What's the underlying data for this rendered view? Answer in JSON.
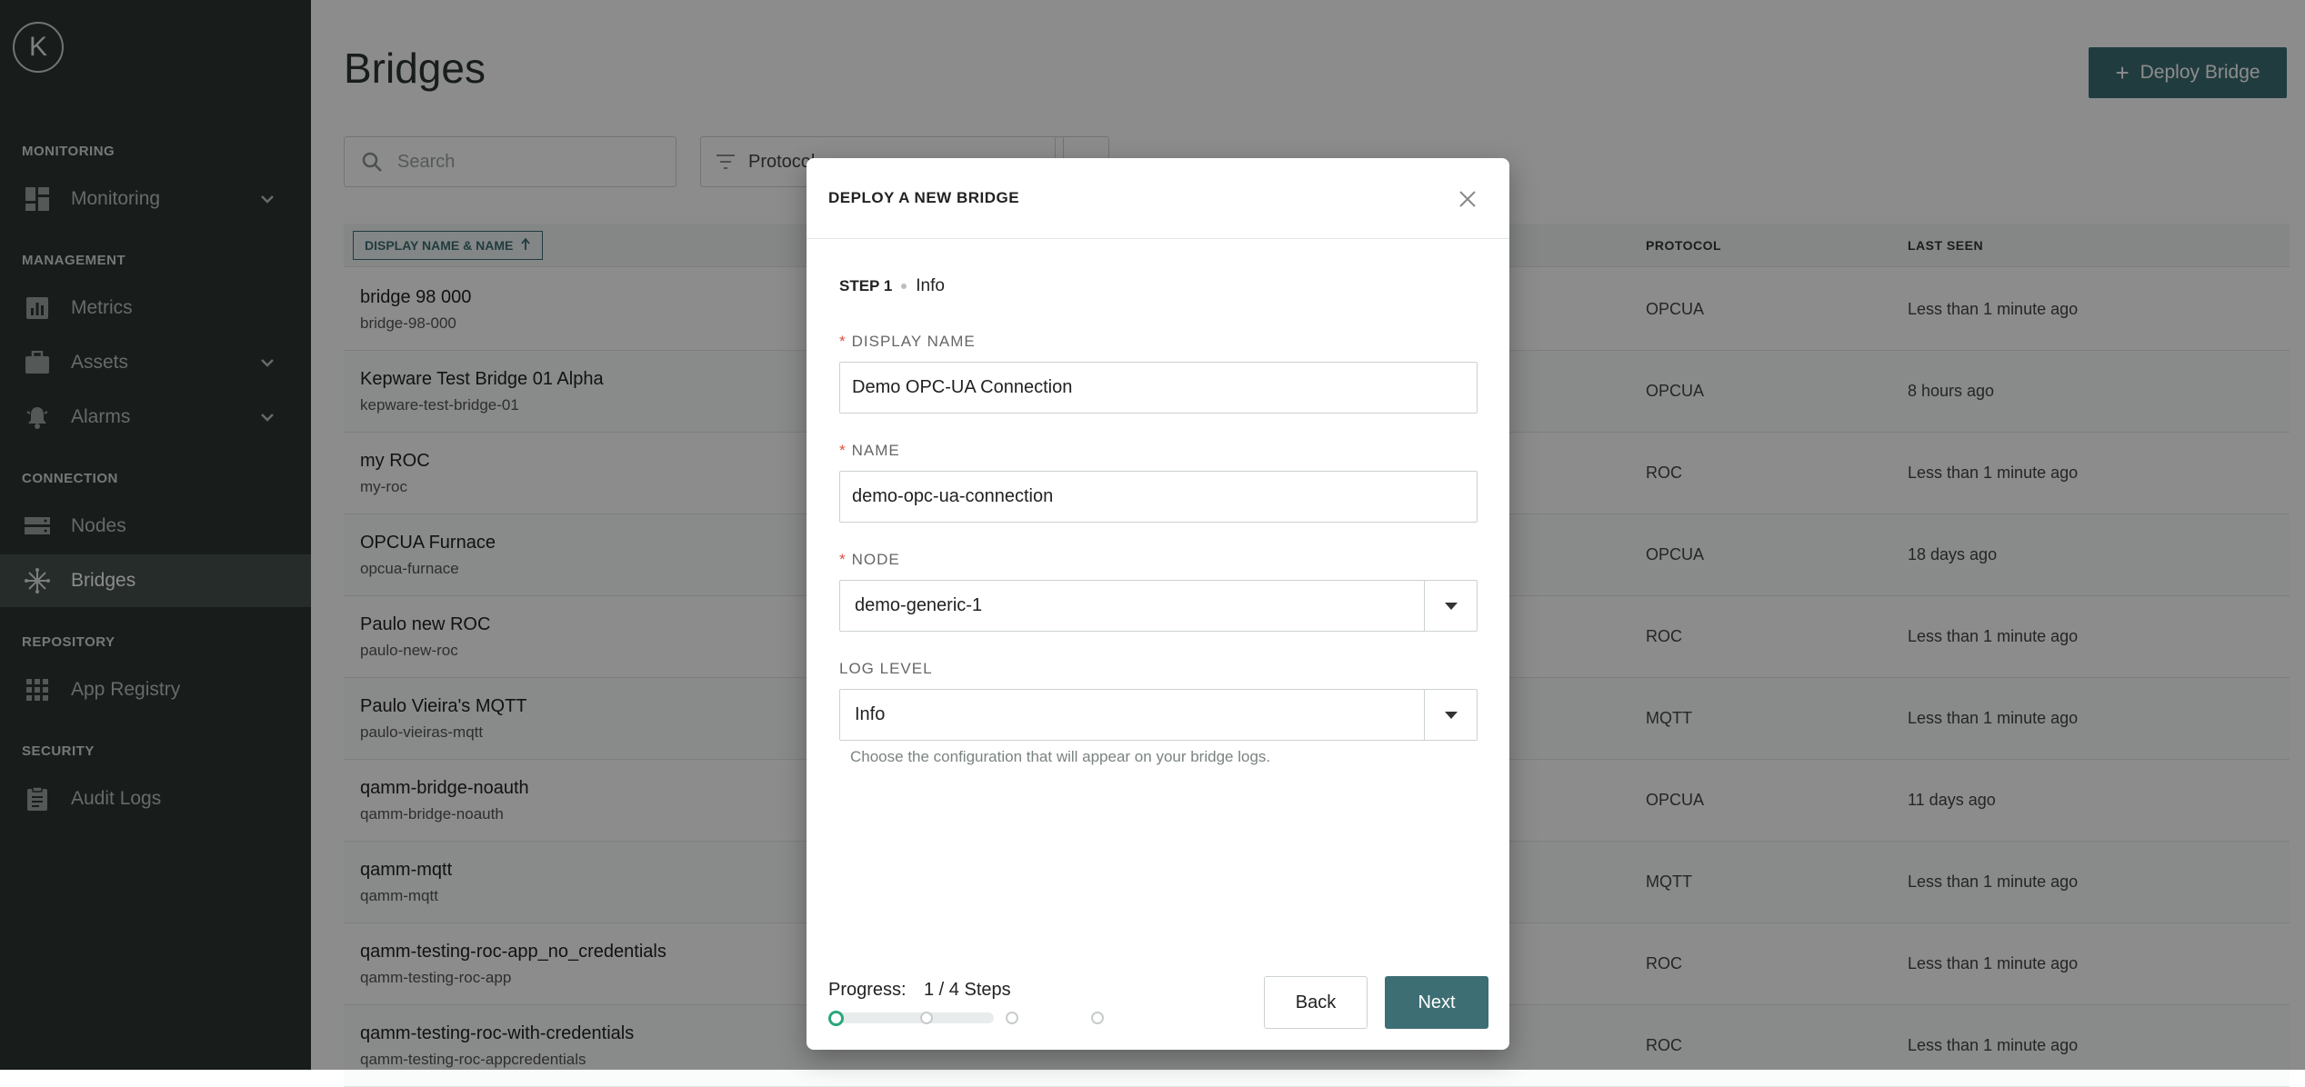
{
  "sidebar": {
    "logo": "K",
    "sections": {
      "monitoring": "MONITORING",
      "management": "MANAGEMENT",
      "connection": "CONNECTION",
      "repository": "REPOSITORY",
      "security": "SECURITY"
    },
    "items": [
      {
        "label": "Monitoring",
        "icon": "dashboard-icon"
      },
      {
        "label": "Metrics",
        "icon": "chart-icon"
      },
      {
        "label": "Assets",
        "icon": "briefcase-icon"
      },
      {
        "label": "Alarms",
        "icon": "bell-icon"
      },
      {
        "label": "Nodes",
        "icon": "server-icon"
      },
      {
        "label": "Bridges",
        "icon": "hub-icon"
      },
      {
        "label": "App Registry",
        "icon": "grid-icon"
      },
      {
        "label": "Audit Logs",
        "icon": "clipboard-icon"
      }
    ]
  },
  "page": {
    "title": "Bridges",
    "deploy_button": "Deploy Bridge",
    "search_placeholder": "Search",
    "filter_label": "Protocol"
  },
  "table": {
    "sort_header": "DISPLAY NAME & NAME",
    "headers": {
      "protocol": "PROTOCOL",
      "last_seen": "LAST SEEN"
    },
    "rows": [
      {
        "name": "bridge 98 000",
        "id": "bridge-98-000",
        "protocol": "OPCUA",
        "last_seen": "Less than 1 minute ago"
      },
      {
        "name": "Kepware Test Bridge 01 Alpha",
        "id": "kepware-test-bridge-01",
        "protocol": "OPCUA",
        "last_seen": "8 hours ago"
      },
      {
        "name": "my ROC",
        "id": "my-roc",
        "protocol": "ROC",
        "last_seen": "Less than 1 minute ago"
      },
      {
        "name": "OPCUA Furnace",
        "id": "opcua-furnace",
        "protocol": "OPCUA",
        "last_seen": "18 days ago"
      },
      {
        "name": "Paulo new ROC",
        "id": "paulo-new-roc",
        "protocol": "ROC",
        "last_seen": "Less than 1 minute ago"
      },
      {
        "name": "Paulo Vieira's MQTT",
        "id": "paulo-vieiras-mqtt",
        "protocol": "MQTT",
        "last_seen": "Less than 1 minute ago"
      },
      {
        "name": "qamm-bridge-noauth",
        "id": "qamm-bridge-noauth",
        "protocol": "OPCUA",
        "last_seen": "11 days ago"
      },
      {
        "name": "qamm-mqtt",
        "id": "qamm-mqtt",
        "protocol": "MQTT",
        "last_seen": "Less than 1 minute ago"
      },
      {
        "name": "qamm-testing-roc-app_no_credentials",
        "id": "qamm-testing-roc-app",
        "protocol": "ROC",
        "last_seen": "Less than 1 minute ago"
      },
      {
        "name": "qamm-testing-roc-with-credentials",
        "id": "qamm-testing-roc-appcredentials",
        "protocol": "ROC",
        "last_seen": "Less than 1 minute ago"
      }
    ]
  },
  "modal": {
    "title": "DEPLOY A NEW BRIDGE",
    "step_number": "STEP 1",
    "step_name": "Info",
    "display_name_label": "DISPLAY NAME",
    "display_name_value": "Demo OPC-UA Connection",
    "name_label": "NAME",
    "name_value": "demo-opc-ua-connection",
    "node_label": "NODE",
    "node_value": "demo-generic-1",
    "log_level_label": "LOG LEVEL",
    "log_level_value": "Info",
    "log_level_help": "Choose the configuration that will appear on your bridge logs.",
    "progress_label": "Progress:",
    "progress_value": "1 / 4 Steps",
    "progress_fraction": 0.25,
    "back_button": "Back",
    "next_button": "Next"
  },
  "colors": {
    "sidebar_bg": "#2c3533",
    "accent": "#3d6e74",
    "progress_active": "#2aa77a",
    "required": "#e04f3a"
  }
}
